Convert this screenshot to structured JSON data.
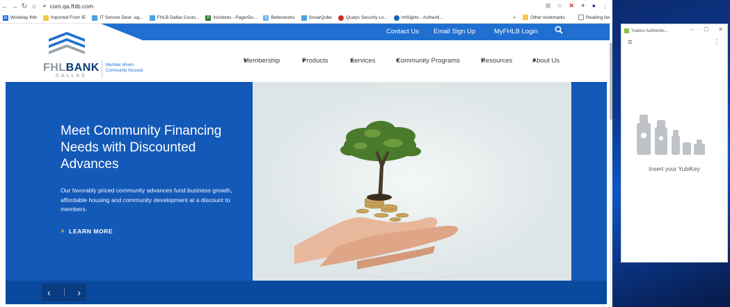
{
  "browser": {
    "url": "com.qa.fhlb.com",
    "bookmarks": [
      {
        "label": "Workday fhlb",
        "color": "#1a73e8"
      },
      {
        "label": "Imported From IE",
        "color": "#f2c94c"
      },
      {
        "label": "IT Service Desk -ag...",
        "color": "#4aa3df"
      },
      {
        "label": "FHLB Dallas Custo...",
        "color": "#4aa3df"
      },
      {
        "label": "Incidents - PagerDu...",
        "color": "#2e7d32"
      },
      {
        "label": "Betterworks",
        "color": "#64b5f6"
      },
      {
        "label": "SonarQube",
        "color": "#4aa3df"
      },
      {
        "label": "Qualys Security Lo...",
        "color": "#d32f2f"
      },
      {
        "label": "IntSights - Authenti...",
        "color": "#1565c0"
      }
    ],
    "overflow": "»",
    "other_bookmarks": "Other bookmarks",
    "reading_list": "Reading list"
  },
  "site": {
    "utility_links": {
      "contact": "Contact Us",
      "email": "Email Sign Up",
      "login": "MyFHLB Login"
    },
    "logo": {
      "brand_part1": "FHL",
      "brand_part2": "BANK",
      "city": "DALLAS",
      "tagline_line1": "Member driven.",
      "tagline_line2": "Community focused."
    },
    "nav": {
      "membership": "Membership",
      "products": "Products",
      "services": "Services",
      "community": "Community Programs",
      "resources": "Resources",
      "about": "About Us"
    },
    "hero": {
      "title": "Meet Community Financing Needs with Discounted Advances",
      "body": "Our favorably priced community advances fund business growth, affordable housing and community development at a discount to members.",
      "cta": "LEARN MORE"
    }
  },
  "yubico": {
    "title": "Yubico Authentic...",
    "message": "Insert your YubiKey"
  },
  "colors": {
    "brand_blue": "#1f6fd0",
    "hero_blue": "#1359b8",
    "accent": "#f5b400"
  }
}
